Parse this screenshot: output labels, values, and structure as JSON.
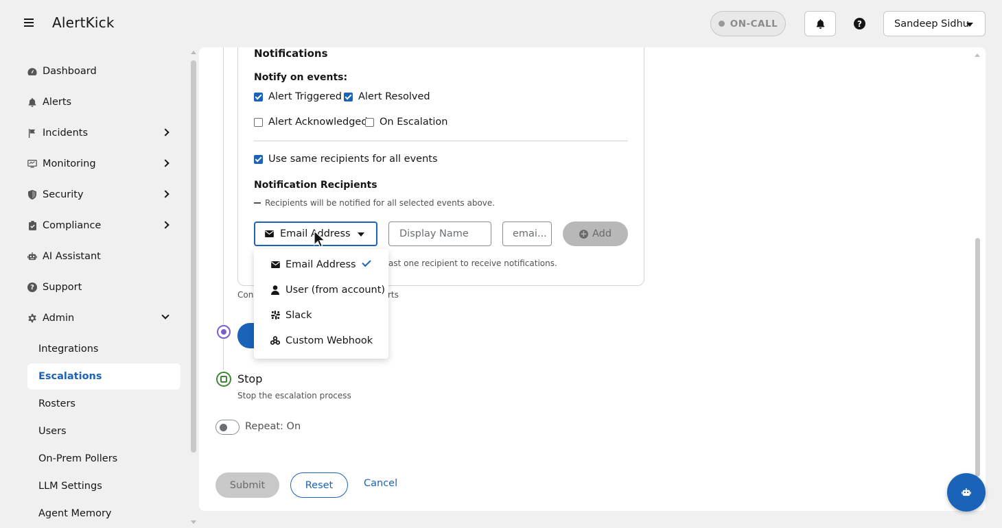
{
  "app": {
    "title": "AlertKick"
  },
  "header": {
    "oncall_label": "ON-CALL",
    "user_name": "Sandeep Sidhu"
  },
  "sidebar": {
    "items": [
      {
        "label": "Dashboard",
        "icon": "dashboard-icon"
      },
      {
        "label": "Alerts",
        "icon": "bell-icon"
      },
      {
        "label": "Incidents",
        "icon": "flag-icon",
        "expandable": true
      },
      {
        "label": "Monitoring",
        "icon": "monitor-icon",
        "expandable": true
      },
      {
        "label": "Security",
        "icon": "shield-icon",
        "expandable": true
      },
      {
        "label": "Compliance",
        "icon": "clipboard-check-icon",
        "expandable": true
      },
      {
        "label": "AI Assistant",
        "icon": "robot-icon"
      },
      {
        "label": "Support",
        "icon": "question-circle-icon"
      },
      {
        "label": "Admin",
        "icon": "gear-icon",
        "expanded": true
      }
    ],
    "admin_sub": [
      {
        "label": "Integrations"
      },
      {
        "label": "Escalations",
        "active": true
      },
      {
        "label": "Rosters"
      },
      {
        "label": "Users"
      },
      {
        "label": "On-Prem Pollers"
      },
      {
        "label": "LLM Settings"
      },
      {
        "label": "Agent Memory"
      }
    ]
  },
  "notifications": {
    "title": "Notifications",
    "notify_on_events_label": "Notify on events:",
    "events": [
      {
        "label": "Alert Triggered",
        "checked": true
      },
      {
        "label": "Alert Resolved",
        "checked": true
      },
      {
        "label": "Alert Acknowledged",
        "checked": false
      },
      {
        "label": "On Escalation",
        "checked": false
      }
    ],
    "same_recipients": {
      "label": "Use same recipients for all events",
      "checked": true
    },
    "recipients_title": "Notification Recipients",
    "recipients_helper": "Recipients will be notified for all selected events above.",
    "type_select_value": "Email Address",
    "display_name_placeholder": "Display Name",
    "email_placeholder": "emai...",
    "add_label": "Add",
    "hint_visible": "ast one recipient to receive notifications."
  },
  "step_text_prefix": "Cont",
  "step_text_suffix": "rts",
  "stop_step": {
    "title": "Stop",
    "description": "Stop the escalation process"
  },
  "repeat_toggle": {
    "label": "Repeat: On",
    "on": false
  },
  "actions": {
    "submit": "Submit",
    "reset": "Reset",
    "cancel": "Cancel"
  },
  "dropdown": {
    "options": [
      {
        "label": "Email Address",
        "icon": "envelope-icon",
        "selected": true
      },
      {
        "label": "User (from account)",
        "icon": "user-icon",
        "selected": false
      },
      {
        "label": "Slack",
        "icon": "slack-icon",
        "selected": false
      },
      {
        "label": "Custom Webhook",
        "icon": "webhook-icon",
        "selected": false
      }
    ]
  },
  "colors": {
    "accent": "#1a63b8",
    "background": "#f0f0f0",
    "stop_green": "#3e8635",
    "step_purple": "#7b5ec9"
  }
}
